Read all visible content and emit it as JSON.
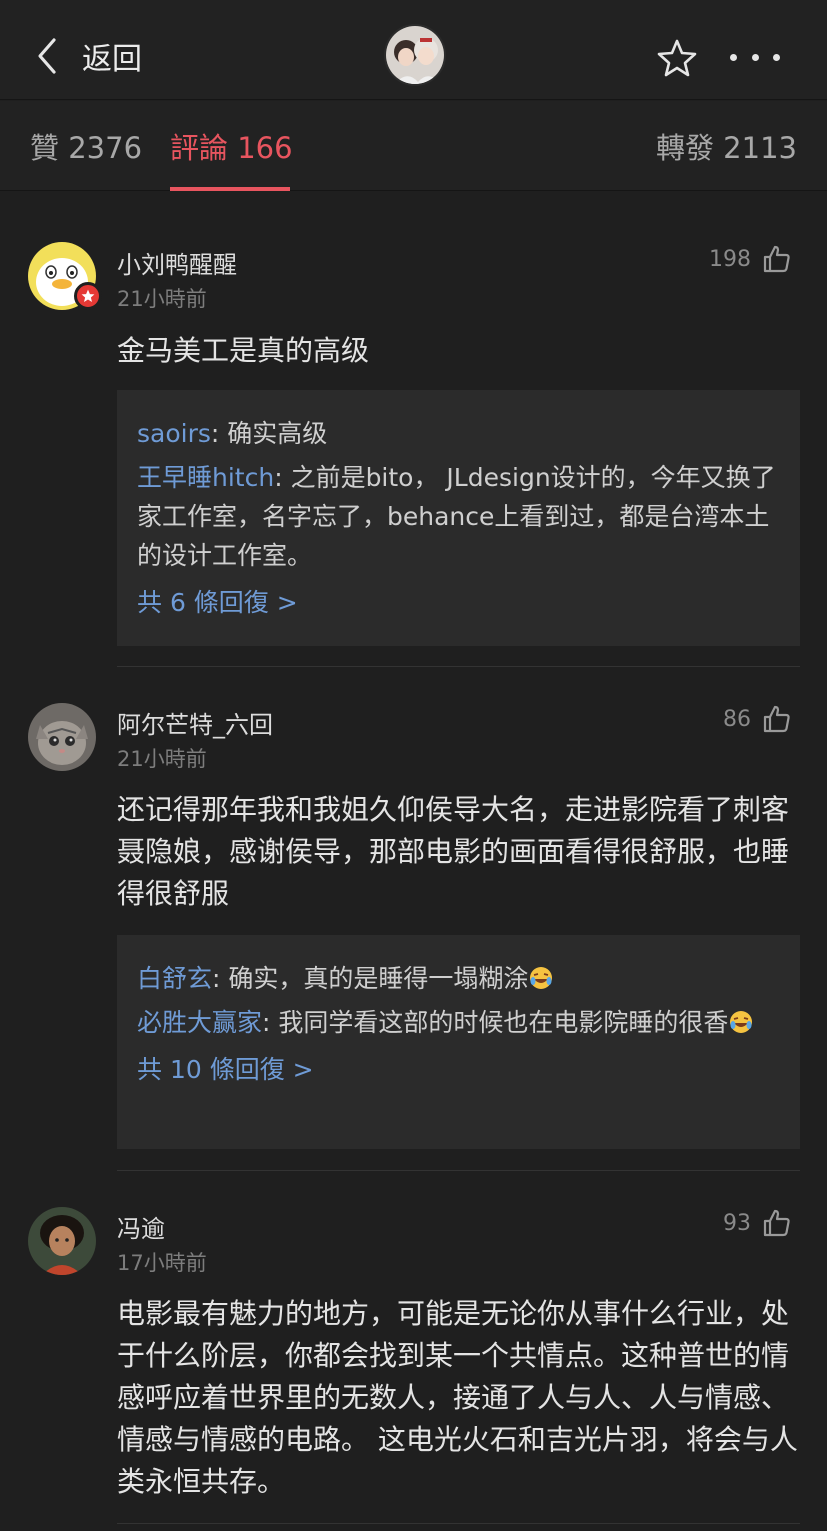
{
  "header": {
    "back_label": "返回",
    "icons": {
      "back": "chevron-left-icon",
      "favorite": "star-icon",
      "more": "more-horizontal-icon"
    }
  },
  "tabs": [
    {
      "label": "贊 2376",
      "active": false
    },
    {
      "label": "評論 166",
      "active": true
    },
    {
      "label": "轉發 2113",
      "active": false
    }
  ],
  "colors": {
    "accent": "#e8555f",
    "link": "#6f9bd6",
    "background": "#1f1f1f",
    "reply_bg": "#2b2b2b"
  },
  "comments": [
    {
      "username": "小刘鸭醒醒",
      "time": "21小時前",
      "likes": "198",
      "text": "金马美工是真的高级",
      "replies": [
        {
          "name": "saoirs",
          "sep": ": ",
          "text": "确实高级"
        },
        {
          "name": "王早睡hitch",
          "sep": ": ",
          "text": "之前是bito， JLdesign设计的，今年又换了家工作室，名字忘了，behance上看到过，都是台湾本土的设计工作室。"
        }
      ],
      "more_replies": "共 6 條回復 >"
    },
    {
      "username": "阿尔芒特_六回",
      "time": "21小時前",
      "likes": "86",
      "text": "还记得那年我和我姐久仰侯导大名，走进影院看了刺客聂隐娘，感谢侯导，那部电影的画面看得很舒服，也睡得很舒服",
      "replies": [
        {
          "name": "白舒玄",
          "sep": ": ",
          "text": "确实，真的是睡得一塌糊涂"
        },
        {
          "name": "必胜大赢家",
          "sep": ": ",
          "text": "我同学看这部的时候也在电影院睡的很香"
        }
      ],
      "more_replies": "共 10 條回復 >"
    },
    {
      "username": "冯逾",
      "time": "17小時前",
      "likes": "93",
      "text": "电影最有魅力的地方，可能是无论你从事什么行业，处于什么阶层，你都会找到某一个共情点。这种普世的情感呼应着世界里的无数人，接通了人与人、人与情感、情感与情感的电路。 这电光火石和吉光片羽，将会与人类永恒共存。"
    }
  ]
}
